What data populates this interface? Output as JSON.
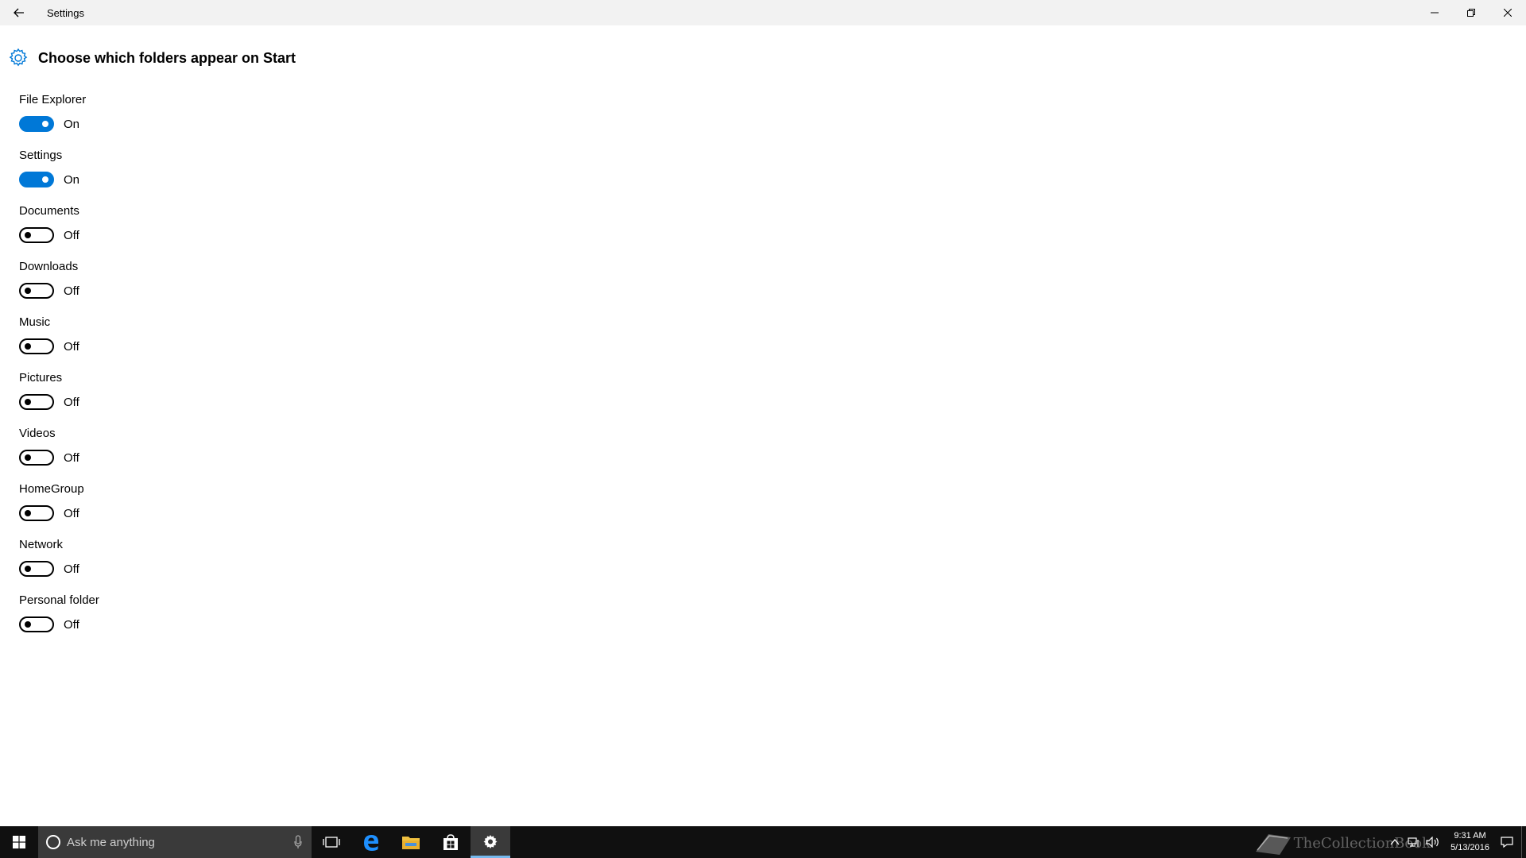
{
  "window": {
    "title": "Settings"
  },
  "header": {
    "title": "Choose which folders appear on Start"
  },
  "folders": [
    {
      "label": "File Explorer",
      "state": "On",
      "on": true
    },
    {
      "label": "Settings",
      "state": "On",
      "on": true
    },
    {
      "label": "Documents",
      "state": "Off",
      "on": false
    },
    {
      "label": "Downloads",
      "state": "Off",
      "on": false
    },
    {
      "label": "Music",
      "state": "Off",
      "on": false
    },
    {
      "label": "Pictures",
      "state": "Off",
      "on": false
    },
    {
      "label": "Videos",
      "state": "Off",
      "on": false
    },
    {
      "label": "HomeGroup",
      "state": "Off",
      "on": false
    },
    {
      "label": "Network",
      "state": "Off",
      "on": false
    },
    {
      "label": "Personal folder",
      "state": "Off",
      "on": false
    }
  ],
  "taskbar": {
    "search_placeholder": "Ask me anything",
    "time": "9:31 AM",
    "date": "5/13/2016",
    "watermark": "TheCollectionBook"
  },
  "colors": {
    "accent": "#0078d7",
    "taskbar": "#101010",
    "titlebar": "#f2f2f2"
  }
}
